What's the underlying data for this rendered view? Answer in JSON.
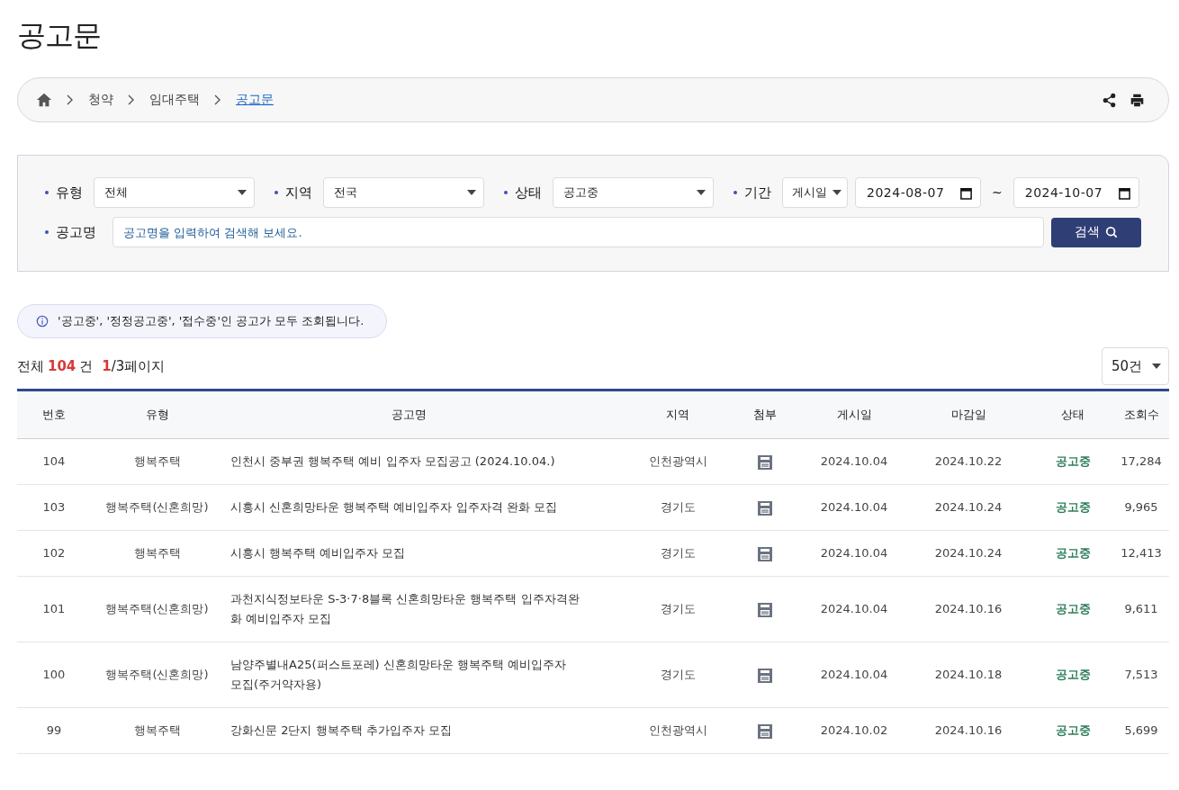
{
  "page_title": "공고문",
  "breadcrumb": [
    {
      "label": "청약",
      "current": false
    },
    {
      "label": "임대주택",
      "current": false
    },
    {
      "label": "공고문",
      "current": true
    }
  ],
  "filters": {
    "type": {
      "label": "유형",
      "value": "전체"
    },
    "region": {
      "label": "지역",
      "value": "전국"
    },
    "status": {
      "label": "상태",
      "value": "공고중"
    },
    "period": {
      "label": "기간",
      "basis": "게시일",
      "from": "2024-08-07",
      "separator": "~",
      "to": "2024-10-07"
    },
    "name": {
      "label": "공고명",
      "placeholder": "공고명을 입력하여 검색해 보세요."
    },
    "search_button": "검색"
  },
  "notice": "'공고중', '정정공고중', '접수중'인 공고가 모두 조회됩니다.",
  "summary": {
    "prefix": "전체",
    "total": "104",
    "unit": "건",
    "page": "1",
    "pages": "/3페이지"
  },
  "page_size": "50건",
  "table": {
    "columns": [
      "번호",
      "유형",
      "공고명",
      "지역",
      "첨부",
      "게시일",
      "마감일",
      "상태",
      "조회수"
    ],
    "rows": [
      {
        "no": "104",
        "type": "행복주택",
        "title": "인천시 중부권 행복주택 예비 입주자 모집공고 (2024.10.04.)",
        "region": "인천광역시",
        "attached": true,
        "posted": "2024.10.04",
        "deadline": "2024.10.22",
        "status": "공고중",
        "views": "17,284"
      },
      {
        "no": "103",
        "type": "행복주택(신혼희망)",
        "title": "시흥시 신혼희망타운 행복주택 예비입주자 입주자격 완화 모집",
        "region": "경기도",
        "attached": true,
        "posted": "2024.10.04",
        "deadline": "2024.10.24",
        "status": "공고중",
        "views": "9,965"
      },
      {
        "no": "102",
        "type": "행복주택",
        "title": "시흥시 행복주택 예비입주자 모집",
        "region": "경기도",
        "attached": true,
        "posted": "2024.10.04",
        "deadline": "2024.10.24",
        "status": "공고중",
        "views": "12,413"
      },
      {
        "no": "101",
        "type": "행복주택(신혼희망)",
        "title": "과천지식정보타운 S-3·7·8블록 신혼희망타운 행복주택 입주자격완화 예비입주자 모집",
        "region": "경기도",
        "attached": true,
        "posted": "2024.10.04",
        "deadline": "2024.10.16",
        "status": "공고중",
        "views": "9,611"
      },
      {
        "no": "100",
        "type": "행복주택(신혼희망)",
        "title": "남양주별내A25(퍼스트포레) 신혼희망타운 행복주택 예비입주자 모집(주거약자용)",
        "region": "경기도",
        "attached": true,
        "posted": "2024.10.04",
        "deadline": "2024.10.18",
        "status": "공고중",
        "views": "7,513"
      },
      {
        "no": "99",
        "type": "행복주택",
        "title": "강화신문 2단지 행복주택 추가입주자 모집",
        "region": "인천광역시",
        "attached": true,
        "posted": "2024.10.02",
        "deadline": "2024.10.16",
        "status": "공고중",
        "views": "5,699"
      }
    ]
  }
}
